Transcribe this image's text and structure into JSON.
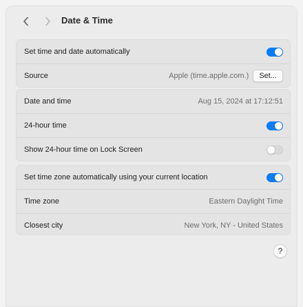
{
  "header": {
    "title": "Date & Time",
    "back_icon": "chevron-left-icon",
    "forward_icon": "chevron-right-icon"
  },
  "colors": {
    "accent": "#0a7cf5",
    "toggle_off": "#dadada"
  },
  "group1": {
    "auto_time_label": "Set time and date automatically",
    "auto_time_on": true,
    "source_label": "Source",
    "source_value": "Apple (time.apple.com.)",
    "set_button_label": "Set..."
  },
  "group2": {
    "date_time_label": "Date and time",
    "date_time_value": "Aug 15, 2024 at 17:12:51",
    "h24_label": "24-hour time",
    "h24_on": true,
    "lock_label": "Show 24-hour time on Lock Screen",
    "lock_on": false
  },
  "group3": {
    "auto_tz_label": "Set time zone automatically using your current location",
    "auto_tz_on": true,
    "tz_label": "Time zone",
    "tz_value": "Eastern Daylight Time",
    "city_label": "Closest city",
    "city_value": "New York, NY - United States"
  },
  "help": {
    "label": "?"
  }
}
